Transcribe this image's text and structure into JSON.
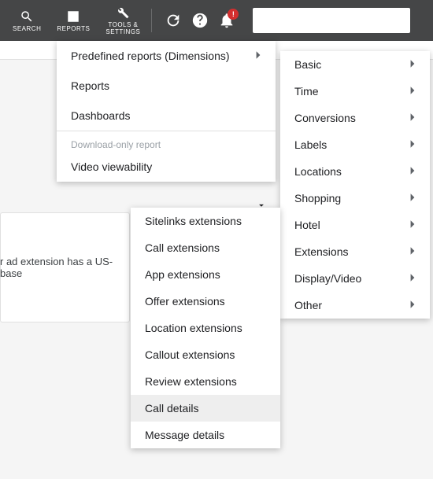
{
  "toolbar": {
    "search_label": "SEARCH",
    "reports_label": "REPORTS",
    "tools_label": "TOOLS &\nSETTINGS",
    "badge": "!"
  },
  "bg": {
    "card_text": "r ad extension has a US-base"
  },
  "reports_menu": {
    "items": [
      {
        "label": "Predefined reports (Dimensions)",
        "arrow": true
      },
      {
        "label": "Reports",
        "arrow": false
      },
      {
        "label": "Dashboards",
        "arrow": false
      }
    ],
    "section_label": "Download-only report",
    "section_items": [
      {
        "label": "Video viewability",
        "arrow": false
      }
    ]
  },
  "categories_menu": {
    "items": [
      {
        "label": "Basic"
      },
      {
        "label": "Time"
      },
      {
        "label": "Conversions"
      },
      {
        "label": "Labels"
      },
      {
        "label": "Locations"
      },
      {
        "label": "Shopping"
      },
      {
        "label": "Hotel"
      },
      {
        "label": "Extensions"
      },
      {
        "label": "Display/Video"
      },
      {
        "label": "Other"
      }
    ]
  },
  "extensions_menu": {
    "items": [
      {
        "label": "Sitelinks extensions"
      },
      {
        "label": "Call extensions"
      },
      {
        "label": "App extensions"
      },
      {
        "label": "Offer extensions"
      },
      {
        "label": "Location extensions"
      },
      {
        "label": "Callout extensions"
      },
      {
        "label": "Review extensions"
      },
      {
        "label": "Call details",
        "highlight": true
      },
      {
        "label": "Message details"
      }
    ]
  }
}
